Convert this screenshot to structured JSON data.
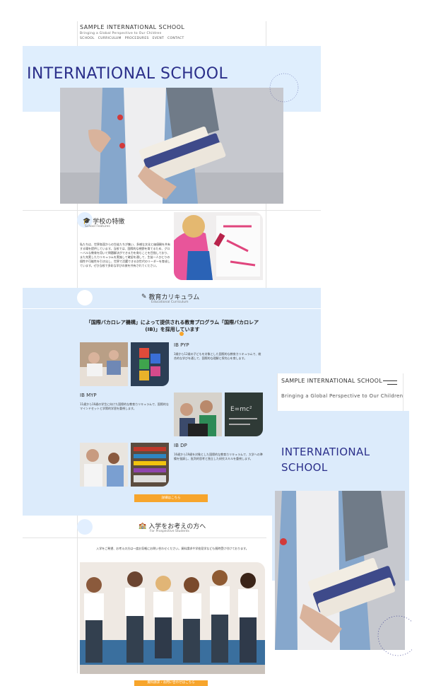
{
  "header": {
    "title": "SAMPLE INTERNATIONAL SCHOOL",
    "subtitle": "Bringing a Global Perspective to Our Children",
    "nav": [
      "SCHOOL",
      "CURRICULUM",
      "PROCEDURES",
      "EVENT",
      "CONTACT"
    ]
  },
  "hero": {
    "title": "INTERNATIONAL SCHOOL"
  },
  "features": {
    "title": "学校の特徴",
    "subtitle": "School Features",
    "text": "私たちは、世界各国からの生徒たちが集い、多様な文化と価値観を共有する場を提供しています。当校では、国際的な視野を育てるため、グローバルな教育を用いて問題解決ができる力を育むことを目指しており、また充実したカリキュラムを実施して確認を通して、生徒一人ひとりの個性や可能性を引き出し、世界で活躍できる次世代のリーダーを育成しています。ぜひ当校で多彩な学びの旅を共有されてください。"
  },
  "curriculum": {
    "title": "教育カリキュラム",
    "subtitle": "Educational Curriculum",
    "headline": "「国際バカロレア機構」によって提供される教育プログラム「国際バカロレア (IB)」を採用しています",
    "programs": [
      {
        "name": "IB PYP",
        "desc": "3歳から12歳の子どもを対象とした国際的な教育カリキュラムで、総合的な学びを通して、国際的な理解と探究心を育します。"
      },
      {
        "name": "IB MYP",
        "desc": "11歳から16歳の学生に向けた国際的な教育カリキュラムで、国際的なマインドセットと学際的学習を重視します。"
      },
      {
        "name": "IB DP",
        "desc": "16歳から19歳を対象とした国際的な教育カリキュラムで、大学への準備を強調し、批判的思考と独立した研究スキルを重視します。"
      }
    ],
    "button": "詳細はこちら"
  },
  "prospective": {
    "title": "入学をお考えの方へ",
    "subtitle": "For Prospective Students",
    "text": "入学をご希望、お考えの方は一度お気軽にお問い合わせください。資料請求や学校見学なども随時受け付けております。",
    "button": "資料請求・お問い合わせはこちら"
  },
  "mobile": {
    "title": "SAMPLE INTERNATIONAL SCHOOL",
    "subtitle": "Bringing a Global Perspective to Our Children",
    "hero": "INTERNATIONAL SCHOOL"
  },
  "colors": {
    "accent_blue": "#dcebfb",
    "title_navy": "#2b2f8a",
    "button_orange": "#f7a52c"
  }
}
